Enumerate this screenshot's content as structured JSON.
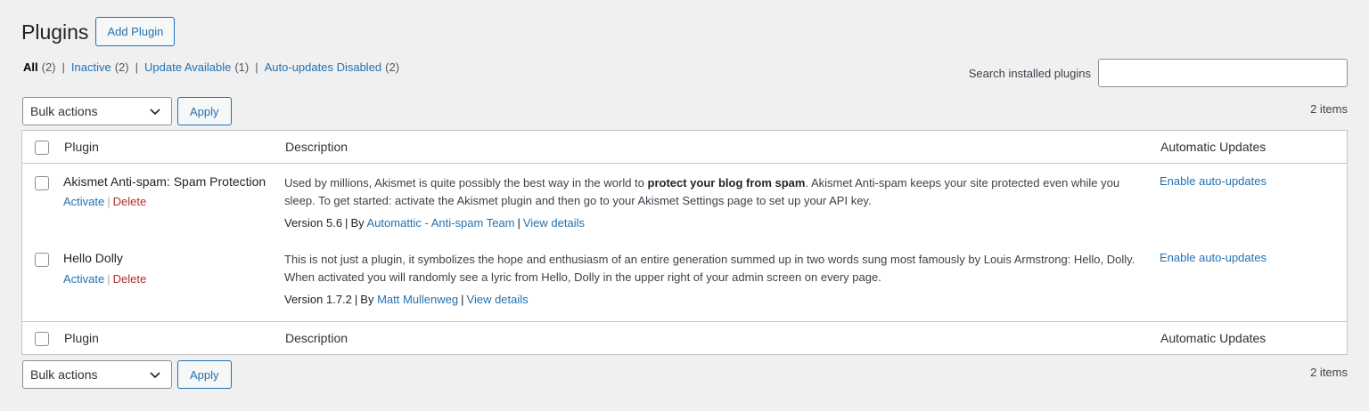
{
  "header": {
    "title": "Plugins",
    "add_button": "Add Plugin"
  },
  "filters": [
    {
      "label": "All",
      "count": "(2)",
      "current": true
    },
    {
      "label": "Inactive",
      "count": "(2)",
      "current": false
    },
    {
      "label": "Update Available",
      "count": "(1)",
      "current": false
    },
    {
      "label": "Auto-updates Disabled",
      "count": "(2)",
      "current": false
    }
  ],
  "search": {
    "label": "Search installed plugins",
    "value": ""
  },
  "tablenav": {
    "bulk_actions": "Bulk actions",
    "apply": "Apply",
    "items": "2 items"
  },
  "columns": {
    "plugin": "Plugin",
    "description": "Description",
    "auto_updates": "Automatic Updates"
  },
  "plugins": [
    {
      "name": "Akismet Anti-spam: Spam Protection",
      "activate": "Activate",
      "delete": "Delete",
      "desc_before": "Used by millions, Akismet is quite possibly the best way in the world to ",
      "desc_bold": "protect your blog from spam",
      "desc_after": ". Akismet Anti-spam keeps your site protected even while you sleep. To get started: activate the Akismet plugin and then go to your Akismet Settings page to set up your API key.",
      "version": "Version 5.6",
      "by": "By",
      "author": "Automattic - Anti-spam Team",
      "details": "View details",
      "auto_update": "Enable auto-updates"
    },
    {
      "name": "Hello Dolly",
      "activate": "Activate",
      "delete": "Delete",
      "desc_before": "This is not just a plugin, it symbolizes the hope and enthusiasm of an entire generation summed up in two words sung most famously by Louis Armstrong: Hello, Dolly. When activated you will randomly see a lyric from Hello, Dolly in the upper right of your admin screen on every page.",
      "desc_bold": "",
      "desc_after": "",
      "version": "Version 1.7.2",
      "by": "By",
      "author": "Matt Mullenweg",
      "details": "View details",
      "auto_update": "Enable auto-updates"
    }
  ],
  "colors": {
    "link": "#2271b1",
    "delete": "#b32d2e",
    "background": "#f0f0f1",
    "border": "#c3c4c7"
  },
  "icons": {
    "select_arrow": "chevron-down-icon"
  }
}
